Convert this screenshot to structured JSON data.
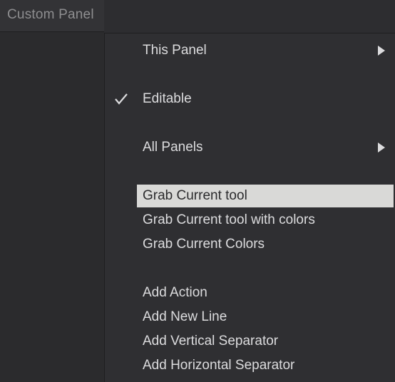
{
  "panel": {
    "title": "Custom Panel"
  },
  "menu": {
    "items": [
      {
        "label": "This Panel",
        "submenu": true
      },
      {
        "label": "Editable",
        "checked": true
      },
      {
        "label": "All Panels",
        "submenu": true
      },
      {
        "label": "Grab Current tool",
        "highlighted": true
      },
      {
        "label": "Grab Current tool with colors"
      },
      {
        "label": "Grab Current Colors"
      },
      {
        "label": "Add Action"
      },
      {
        "label": "Add New Line"
      },
      {
        "label": "Add Vertical Separator"
      },
      {
        "label": "Add Horizontal Separator"
      }
    ]
  },
  "colors": {
    "highlight": "#d9d9d7",
    "menu_bg": "#2f2f32",
    "text": "#dcdcde"
  },
  "icons": {
    "header_dot": "dot-icon",
    "collapse": "collapse-down-icon",
    "close": "close-circle-icon",
    "check": "checkmark-icon",
    "submenu": "submenu-arrow-icon"
  }
}
